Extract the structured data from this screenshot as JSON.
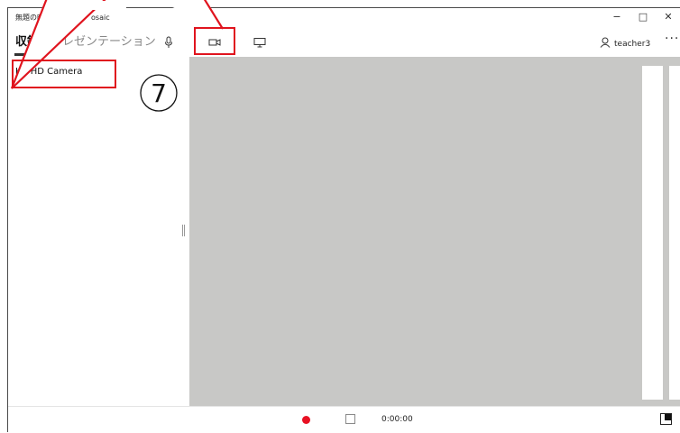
{
  "window": {
    "title_left": "無題の映像",
    "title_right": "osaic",
    "controls": {
      "minimize": "−",
      "maximize": "□",
      "close": "✕"
    }
  },
  "commandbar": {
    "tabs": [
      {
        "label": "収録",
        "active": true
      },
      {
        "label": "プレゼンテーション",
        "active": false
      }
    ],
    "icons": [
      "microphone-icon",
      "camera-icon",
      "screen-icon"
    ],
    "user": {
      "name": "teacher3",
      "icon": "person-icon"
    },
    "more": "···"
  },
  "sidebar": {
    "devices": [
      "HP HD Camera"
    ]
  },
  "annotation": {
    "step": "⑦",
    "color": "#e0141e"
  },
  "bottombar": {
    "timer": "0:00:00",
    "record_color": "#e81123"
  }
}
